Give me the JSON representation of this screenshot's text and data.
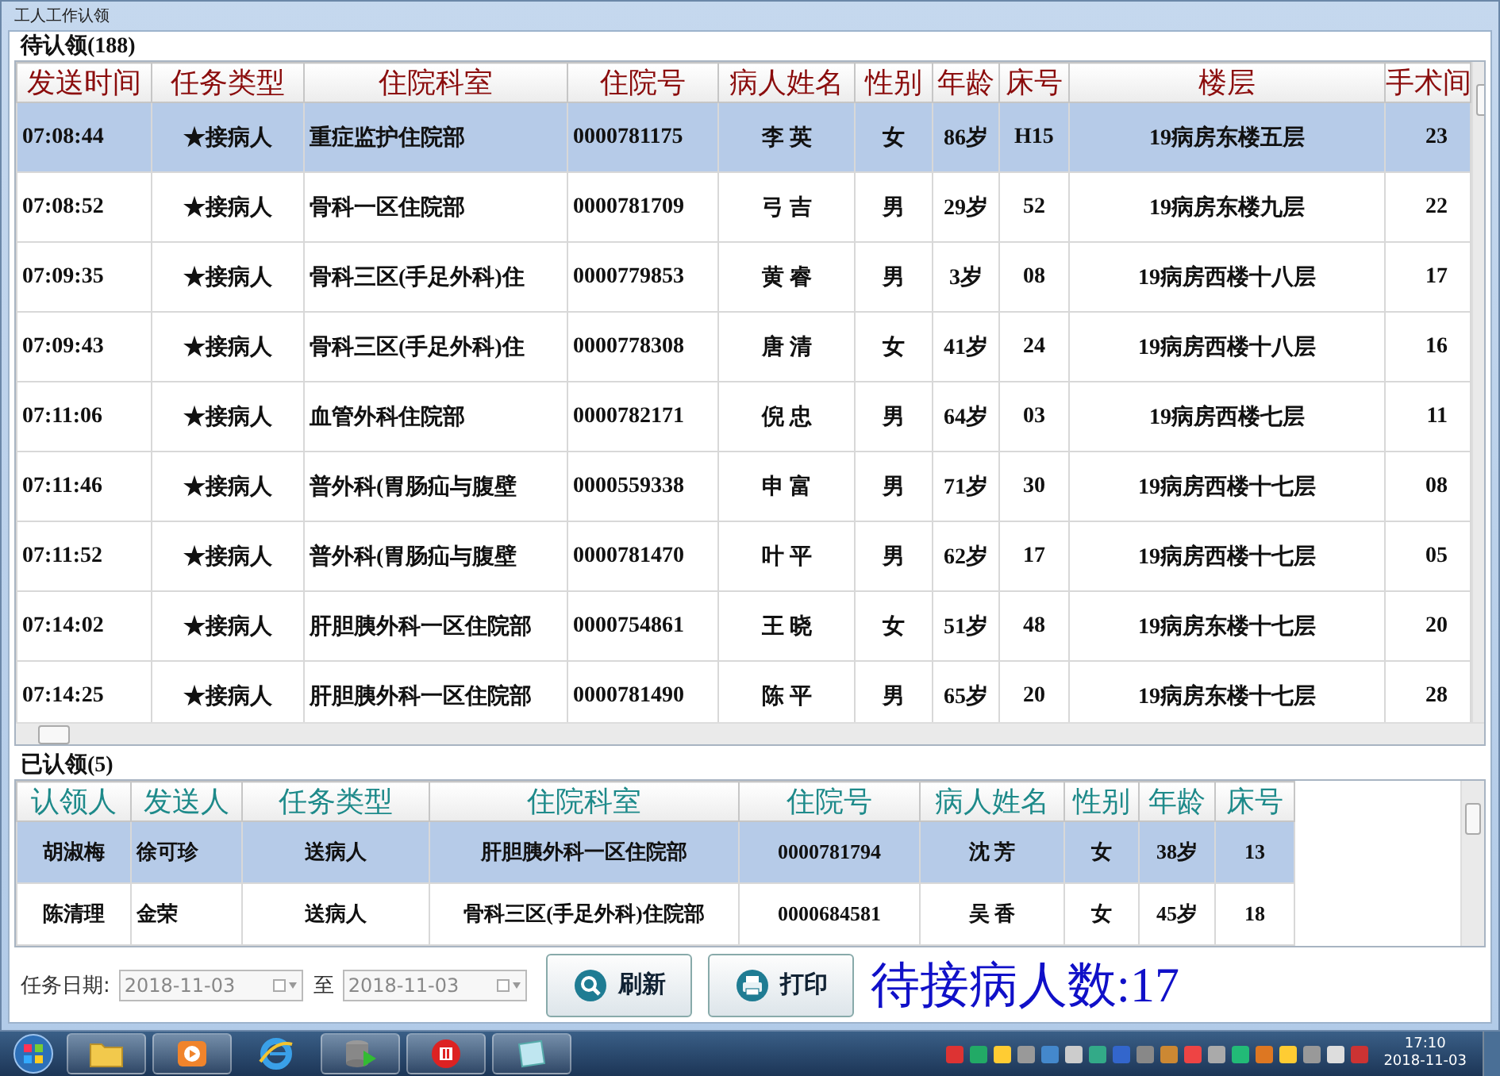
{
  "window": {
    "title": "工人工作认领"
  },
  "pending": {
    "label": "待认领(188)",
    "columns": [
      "发送时间",
      "任务类型",
      "住院科室",
      "住院号",
      "病人姓名",
      "性别",
      "年龄",
      "床号",
      "楼层",
      "手术间"
    ],
    "rows": [
      {
        "selected": true,
        "cells": [
          "07:08:44",
          "★接病人",
          "重症监护住院部",
          "0000781175",
          "李 英",
          "女",
          "86岁",
          "H15",
          "19病房东楼五层",
          "23"
        ]
      },
      {
        "selected": false,
        "cells": [
          "07:08:52",
          "★接病人",
          "骨科一区住院部",
          "0000781709",
          "弓 吉",
          "男",
          "29岁",
          "52",
          "19病房东楼九层",
          "22"
        ]
      },
      {
        "selected": false,
        "cells": [
          "07:09:35",
          "★接病人",
          "骨科三区(手足外科)住",
          "0000779853",
          "黄 睿",
          "男",
          "3岁",
          "08",
          "19病房西楼十八层",
          "17"
        ]
      },
      {
        "selected": false,
        "cells": [
          "07:09:43",
          "★接病人",
          "骨科三区(手足外科)住",
          "0000778308",
          "唐 清",
          "女",
          "41岁",
          "24",
          "19病房西楼十八层",
          "16"
        ]
      },
      {
        "selected": false,
        "cells": [
          "07:11:06",
          "★接病人",
          "血管外科住院部",
          "0000782171",
          "倪 忠",
          "男",
          "64岁",
          "03",
          "19病房西楼七层",
          "11"
        ]
      },
      {
        "selected": false,
        "cells": [
          "07:11:46",
          "★接病人",
          "普外科(胃肠疝与腹壁",
          "0000559338",
          "申 富",
          "男",
          "71岁",
          "30",
          "19病房西楼十七层",
          "08"
        ]
      },
      {
        "selected": false,
        "cells": [
          "07:11:52",
          "★接病人",
          "普外科(胃肠疝与腹壁",
          "0000781470",
          "叶 平",
          "男",
          "62岁",
          "17",
          "19病房西楼十七层",
          "05"
        ]
      },
      {
        "selected": false,
        "cells": [
          "07:14:02",
          "★接病人",
          "肝胆胰外科一区住院部",
          "0000754861",
          "王 晓",
          "女",
          "51岁",
          "48",
          "19病房东楼十七层",
          "20"
        ]
      },
      {
        "selected": false,
        "cells": [
          "07:14:25",
          "★接病人",
          "肝胆胰外科一区住院部",
          "0000781490",
          "陈 平",
          "男",
          "65岁",
          "20",
          "19病房东楼十七层",
          "28"
        ]
      }
    ]
  },
  "claimed": {
    "label": "已认领(5)",
    "columns": [
      "认领人",
      "发送人",
      "任务类型",
      "住院科室",
      "住院号",
      "病人姓名",
      "性别",
      "年龄",
      "床号"
    ],
    "rows": [
      {
        "selected": true,
        "cells": [
          "胡淑梅",
          "徐可珍",
          "送病人",
          "肝胆胰外科一区住院部",
          "0000781794",
          "沈 芳",
          "女",
          "38岁",
          "13"
        ]
      },
      {
        "selected": false,
        "cells": [
          "陈清理",
          "金荣",
          "送病人",
          "骨科三区(手足外科)住院部",
          "0000684581",
          "吴 香",
          "女",
          "45岁",
          "18"
        ]
      }
    ]
  },
  "filter": {
    "label": "任务日期:",
    "from": {
      "value": "2018-11-03",
      "disabled": true
    },
    "separator": "至",
    "to": {
      "value": "2018-11-03",
      "disabled": true
    }
  },
  "buttons": [
    {
      "kind": "refresh",
      "label": "刷新"
    },
    {
      "kind": "print",
      "label": "打印"
    }
  ],
  "waiting_count": "待接病人数:17",
  "taskbar": {
    "time": "17:10",
    "date": "2018-11-03"
  }
}
